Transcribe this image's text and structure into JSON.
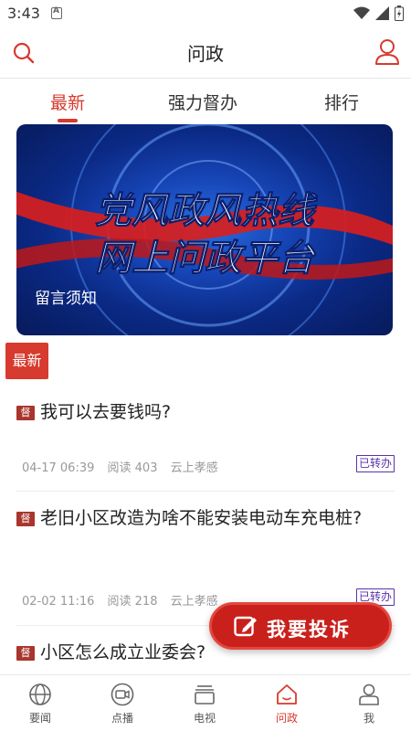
{
  "status_bar": {
    "time": "3:43"
  },
  "header": {
    "title": "问政"
  },
  "tabs": [
    {
      "label": "最新",
      "active": true
    },
    {
      "label": "强力督办",
      "active": false
    },
    {
      "label": "排行",
      "active": false
    }
  ],
  "banner": {
    "line1": "党风政风热线",
    "line2": "网上问政平台",
    "caption": "留言须知"
  },
  "section_badge": "最新",
  "tag_label": "督",
  "items": [
    {
      "title": "我可以去要钱吗?",
      "date": "04-17 06:39",
      "reads": "阅读 403",
      "source": "云上孝感",
      "status": "已转办"
    },
    {
      "title": "老旧小区改造为啥不能安装电动车充电桩?",
      "date": "02-02 11:16",
      "reads": "阅读 218",
      "source": "云上孝感",
      "status": "已转办"
    },
    {
      "title": "小区怎么成立业委会?"
    }
  ],
  "complain_button": {
    "label": "我要投诉"
  },
  "bottom_nav": [
    {
      "label": "要闻",
      "icon": "globe-icon"
    },
    {
      "label": "点播",
      "icon": "video-icon"
    },
    {
      "label": "电视",
      "icon": "tv-icon"
    },
    {
      "label": "问政",
      "icon": "home-icon",
      "active": true
    },
    {
      "label": "我",
      "icon": "person-icon"
    }
  ],
  "colors": {
    "accent": "#d73a2e",
    "status_purple": "#5a32a8",
    "tag_red": "#a8362d"
  }
}
